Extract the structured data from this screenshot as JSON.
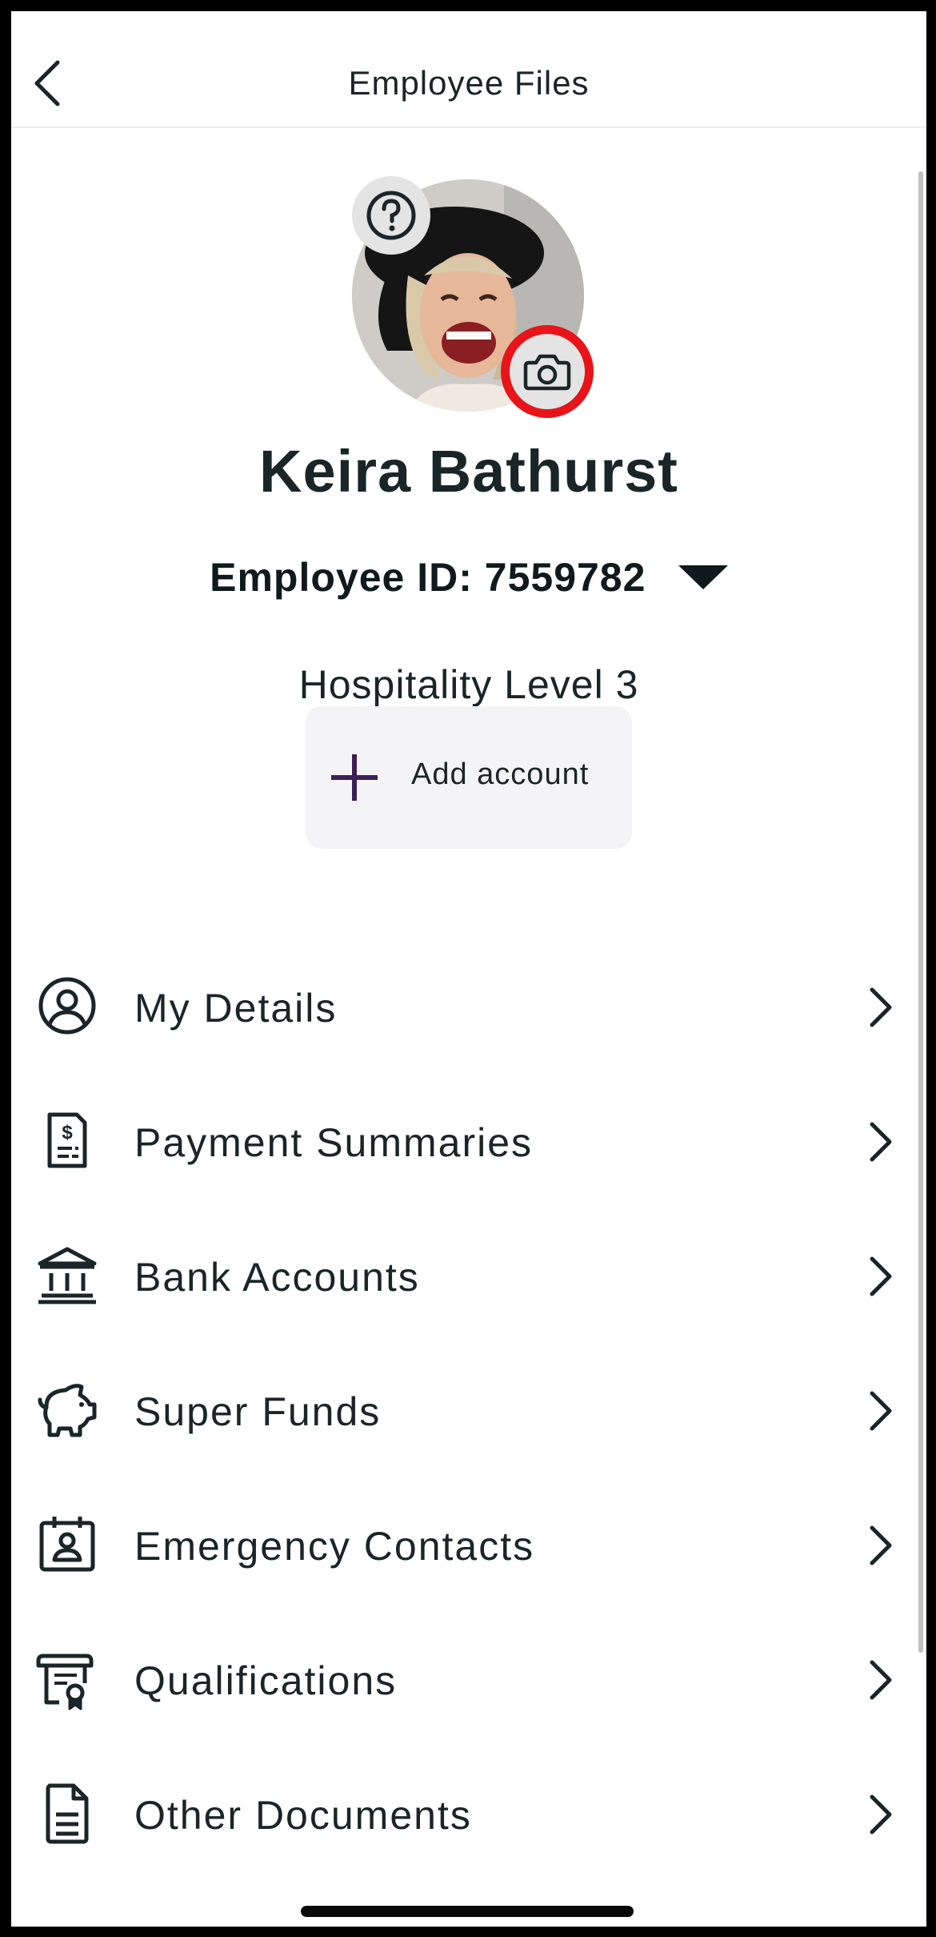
{
  "header": {
    "title": "Employee Files",
    "back_icon": "chevron-left-icon"
  },
  "profile": {
    "name": "Keira Bathurst",
    "employee_id": "Employee ID: 7559782",
    "level": "Hospitality Level 3",
    "help_icon": "question-circle-icon",
    "camera_icon": "camera-icon",
    "camera_highlight_color": "#e8141a"
  },
  "add_account": {
    "label": "Add account",
    "icon": "plus-icon",
    "accent": "#3d1f55"
  },
  "menu": [
    {
      "label": "My Details",
      "icon": "user-circle-icon"
    },
    {
      "label": "Payment Summaries",
      "icon": "receipt-dollar-icon"
    },
    {
      "label": "Bank Accounts",
      "icon": "bank-icon"
    },
    {
      "label": "Super Funds",
      "icon": "piggy-bank-icon"
    },
    {
      "label": "Emergency Contacts",
      "icon": "contact-card-icon"
    },
    {
      "label": "Qualifications",
      "icon": "certificate-icon"
    },
    {
      "label": "Other Documents",
      "icon": "document-icon"
    }
  ]
}
